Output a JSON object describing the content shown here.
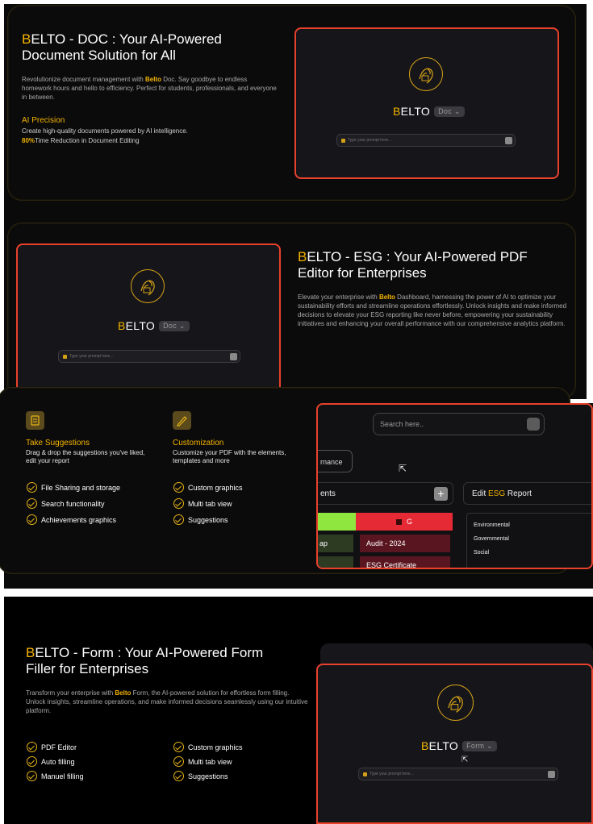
{
  "doc": {
    "title_brand": "B",
    "title_rest_1": "ELTO - DOC : Your AI-Powered",
    "title_line_2": "Document Solution for All",
    "desc_pre": "Revolutionize document management with ",
    "desc_brand": "Belto",
    "desc_post": " Doc. Say goodbye to endless homework hours and hello to efficiency. Perfect for students, professionals, and everyone in between.",
    "feature_title": "AI Precision",
    "feature_desc": "Create high-quality documents powered by AI intelligence.",
    "stat_value": "80%",
    "stat_label": "Time Reduction in Document Editing",
    "preview": {
      "brand_b": "B",
      "brand_rest": "ELTO",
      "pill": "Doc ⌄",
      "prompt": "Type your prompt here..."
    }
  },
  "esg": {
    "title_brand": "B",
    "title_rest_1": "ELTO - ESG : Your AI-Powered PDF",
    "title_line_2": "Editor for Enterprises",
    "desc_pre": "Elevate your enterprise with ",
    "desc_brand": "Belto",
    "desc_post": " Dashboard, harnessing the power of AI to optimize your sustainability efforts and streamline operations effortlessly. Unlock insights and make informed decisions to elevate your ESG reporting like never before, empowering your sustainability initiatives and enhancing your overall performance with our comprehensive analytics platform.",
    "preview": {
      "brand_b": "B",
      "brand_rest": "ELTO",
      "pill": "Doc ⌄",
      "prompt": "Type your prompt here..."
    }
  },
  "suggest": {
    "col1_title": "Take Suggestions",
    "col1_desc": "Drag & drop the suggestions you've liked, edit your report",
    "col1_items": [
      "File Sharing and storage",
      "Search functionality",
      "Achievements graphics"
    ],
    "col2_title": "Customization",
    "col2_desc": "Customize your PDF with the elements, templates and more",
    "col2_items": [
      "Custom graphics",
      "Multi tab view",
      "Suggestions"
    ],
    "dash": {
      "search_placeholder": "Search here..",
      "tab": "rnance",
      "elements_label": "ents",
      "plus": "+",
      "edit_pre": "Edit ",
      "edit_esg": "ESG",
      "edit_post": " Report",
      "red_chip": "G",
      "green_chip_1": "ap",
      "audit": "Audit - 2024",
      "cert": "ESG Certificate",
      "list": [
        "Environmental",
        "Governmental",
        "Social"
      ]
    }
  },
  "form": {
    "title_brand": "B",
    "title_rest_1": "ELTO - Form : Your AI-Powered Form",
    "title_line_2": "Filler for Enterprises",
    "desc_pre": "Transform your enterprise with ",
    "desc_brand": "Belto",
    "desc_post": " Form, the AI-powered solution for effortless form filling. Unlock insights, streamline operations, and make informed decisions seamlessly using our intuitive platform.",
    "col1_items": [
      "PDF Editor",
      "Auto filling",
      "Manuel filling"
    ],
    "col2_items": [
      "Custom graphics",
      "Multi tab view",
      "Suggestions"
    ],
    "preview": {
      "brand_b": "B",
      "brand_rest": "ELTO",
      "pill": "Form ⌄",
      "prompt": "Type your prompt here..."
    }
  }
}
